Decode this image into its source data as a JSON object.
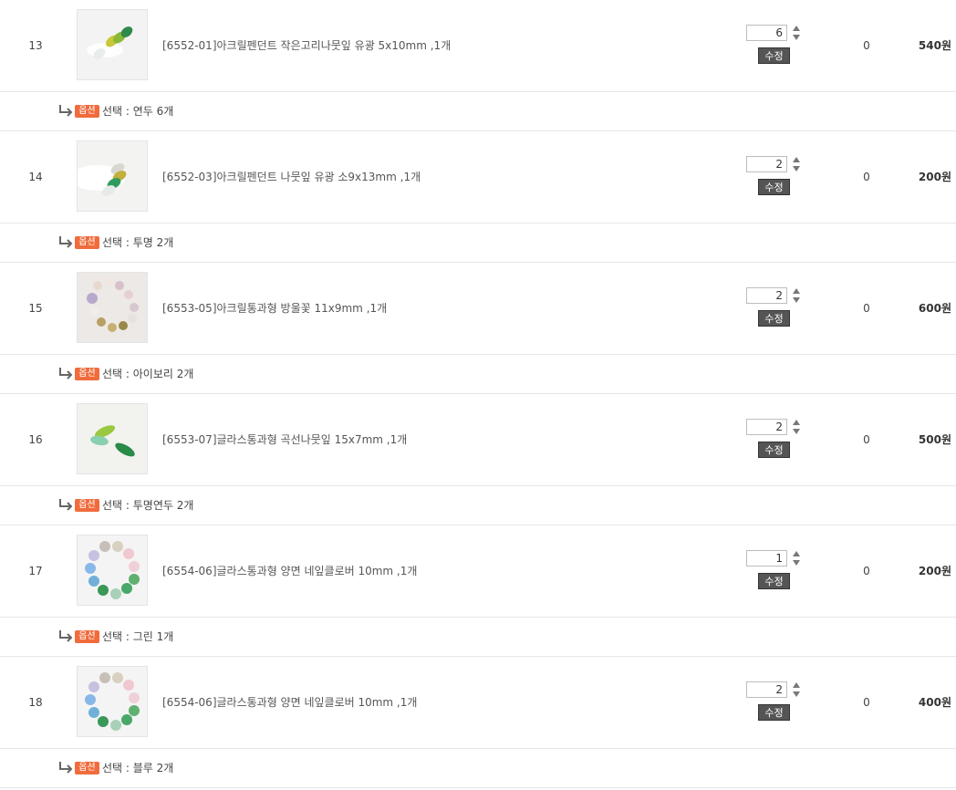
{
  "colors": {
    "badge": "#f06c3c",
    "edit_button": "#555555",
    "border": "#e6e6e6"
  },
  "edit_label": "수정",
  "option_badge": "옵션",
  "items": [
    {
      "no": "13",
      "name": "[6552-01]아크릴펜던트 작은고리나뭇잎 유광 5x10mm ,1개",
      "qty": "6",
      "point": "0",
      "price": "540원",
      "option": "선택 : 연두 6개",
      "thumb_icon": "green-leaf-pendant-image"
    },
    {
      "no": "14",
      "name": "[6552-03]아크릴펜던트 나뭇잎 유광 소9x13mm ,1개",
      "qty": "2",
      "point": "0",
      "price": "200원",
      "option": "선택 : 투명 2개",
      "thumb_icon": "leaf-pendant-image"
    },
    {
      "no": "15",
      "name": "[6553-05]아크릴통과형 방울꽃 11x9mm ,1개",
      "qty": "2",
      "point": "0",
      "price": "600원",
      "option": "선택 : 아이보리 2개",
      "thumb_icon": "bell-flower-beads-image"
    },
    {
      "no": "16",
      "name": "[6553-07]글라스통과형 곡선나뭇잎 15x7mm ,1개",
      "qty": "2",
      "point": "0",
      "price": "500원",
      "option": "선택 : 투명연두 2개",
      "thumb_icon": "curved-leaf-glass-image"
    },
    {
      "no": "17",
      "name": "[6554-06]글라스통과형 양면 네잎클로버 10mm ,1개",
      "qty": "1",
      "point": "0",
      "price": "200원",
      "option": "선택 : 그린 1개",
      "thumb_icon": "clover-glass-beads-image"
    },
    {
      "no": "18",
      "name": "[6554-06]글라스통과형 양면 네잎클로버 10mm ,1개",
      "qty": "2",
      "point": "0",
      "price": "400원",
      "option": "선택 : 블루 2개",
      "thumb_icon": "clover-glass-beads-image"
    }
  ]
}
